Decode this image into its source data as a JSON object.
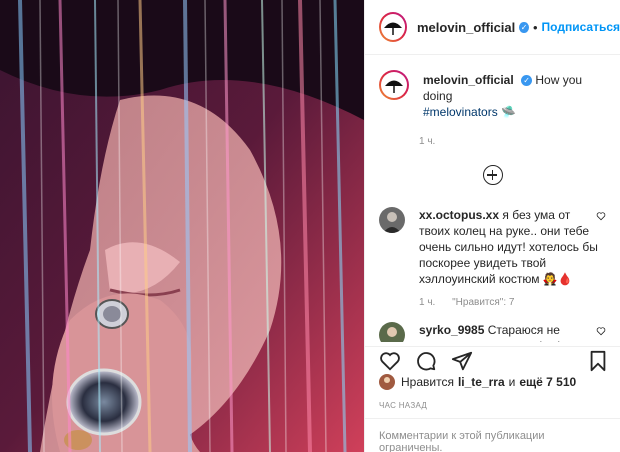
{
  "post": {
    "username": "melovin_official",
    "follow_label": "Подписаться",
    "dot": "•",
    "verified_icon": "verified-badge-icon"
  },
  "caption": {
    "username": "melovin_official",
    "text": "How you doing",
    "hashtag": "#melovinators",
    "emoji": "🛸",
    "time": "1 ч."
  },
  "comments": [
    {
      "username": "xx.octopus.xx",
      "text": "я без ума от твоих колец на руке.. они тебе очень сильно идут! хотелось бы поскорее увидеть твой хэллоуинский костюм 🧛🩸",
      "time": "1 ч.",
      "likes": "\"Нравится\": 7"
    },
    {
      "username": "syrko_9985",
      "text": "Стараюся не палати духом через відмінення туру на цей рік😭, бо чекала на нього більше ніж на це😔"
    }
  ],
  "likes": {
    "prefix": "Нравится",
    "user": "li_te_rra",
    "conj": "и",
    "rest": "ещё 7 510"
  },
  "time_ago": "ЧАС НАЗАД",
  "comments_disabled": "Комментарии к этой публикации ограничены.",
  "colors": {
    "accent": "#0095f6",
    "verified": "#3897f0",
    "muted": "#8e8e8e"
  }
}
